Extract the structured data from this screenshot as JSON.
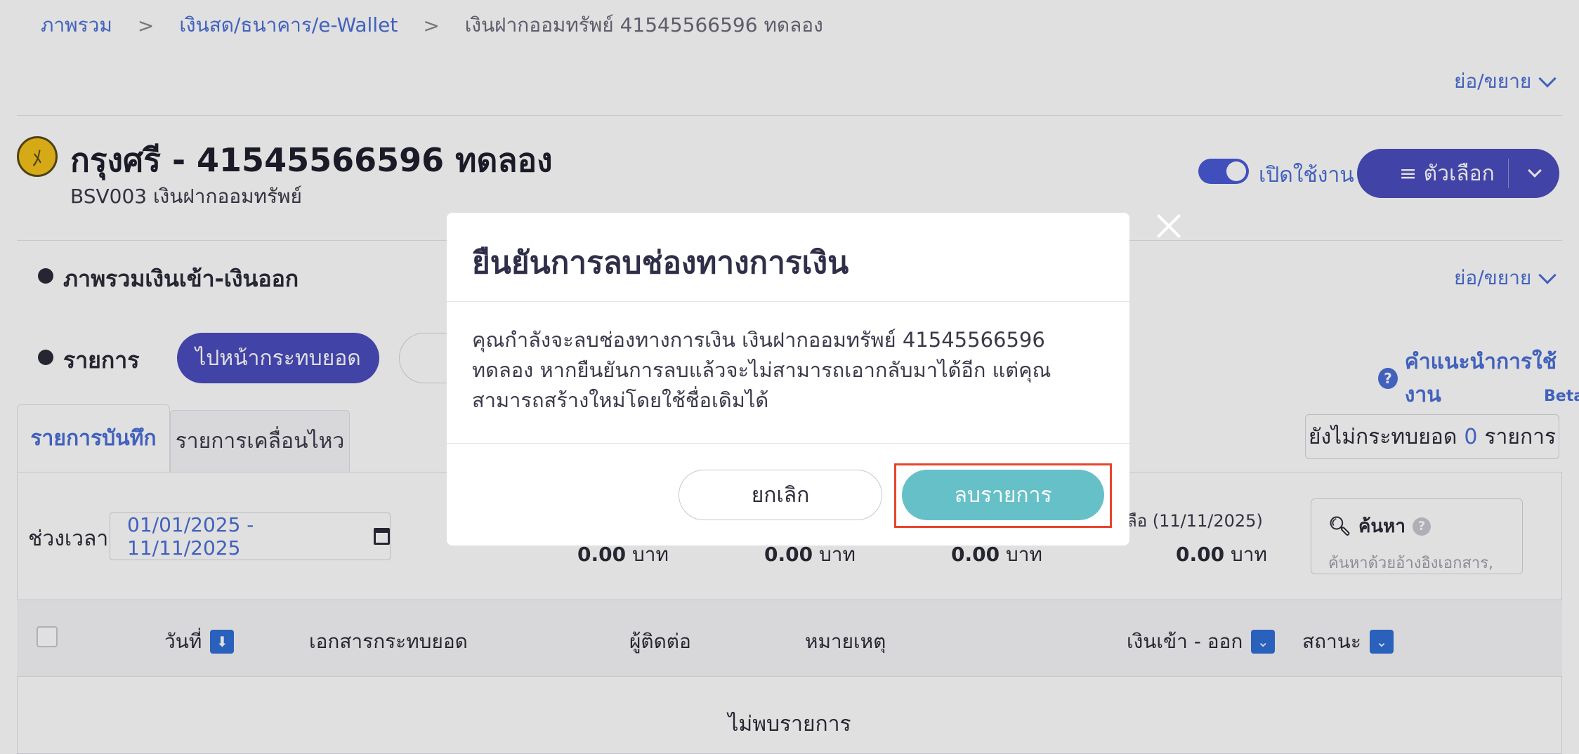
{
  "breadcrumb": {
    "home": "ภาพรวม",
    "category": "เงินสด/ธนาคาร/e-Wallet",
    "current": "เงินฝากออมทรัพย์ 41545566596 ทดลอง",
    "separator": ">"
  },
  "collapse_label": "ย่อ/ขยาย",
  "account": {
    "title": "กรุงศรี - 41545566596 ทดลอง",
    "subtitle": "BSV003 เงินฝากออมทรัพย์",
    "toggle_label": "เปิดใช้งาน",
    "toggle_on": true,
    "options_label": "≡ ตัวเลือก",
    "logo_color": "#f4c21a"
  },
  "sections": {
    "overview_title": "ภาพรวมเงินเข้า-เงินออก",
    "items_title": "รายการ"
  },
  "actions": {
    "reconcile_button": "ไปหน้ากระทบยอด",
    "help_link": "คำแนะนำการใช้งาน",
    "beta": "Beta"
  },
  "tabs": [
    {
      "label": "รายการบันทึก",
      "active": true
    },
    {
      "label": "รายการเคลื่อนไหว",
      "active": false
    }
  ],
  "unreconciled": {
    "prefix": "ยังไม่กระทบยอด",
    "count": "0",
    "suffix": "รายการ"
  },
  "filters": {
    "period_label": "ช่วงเวลา",
    "date_range": "01/01/2025 - 11/11/2025",
    "search_title": "ค้นหา",
    "search_placeholder": "ค้นหาด้วยอ้างอิงเอกสาร,"
  },
  "summary": {
    "values": [
      "0.00",
      "0.00",
      "0.00",
      "0.00"
    ],
    "unit": "บาท",
    "last_label": "ลือ (11/11/2025)"
  },
  "table": {
    "headers": [
      "วันที่",
      "เอกสารกระทบยอด",
      "ผู้ติดต่อ",
      "หมายเหตุ",
      "เงินเข้า - ออก",
      "สถานะ"
    ],
    "empty_text": "ไม่พบรายการ"
  },
  "modal": {
    "title": "ยืนยันการลบช่องทางการเงิน",
    "body": "คุณกำลังจะลบช่องทางการเงิน เงินฝากออมทรัพย์ 41545566596 ทดลอง หากยืนยันการลบแล้วจะไม่สามารถเอากลับมาได้อีก แต่คุณสามารถสร้างใหม่โดยใช้ชื่อเดิมได้",
    "cancel_label": "ยกเลิก",
    "delete_label": "ลบรายการ",
    "delete_color": "#66c0c8",
    "highlight_color": "#e8452a"
  }
}
